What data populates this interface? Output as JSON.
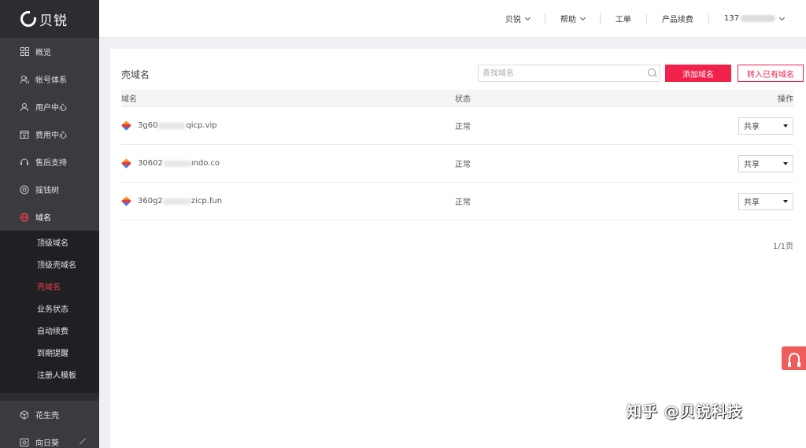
{
  "brand": {
    "name": "贝锐"
  },
  "sidebar": {
    "items": [
      {
        "label": "概览",
        "icon": "dashboard-icon"
      },
      {
        "label": "帐号体系",
        "icon": "users-icon"
      },
      {
        "label": "用户中心",
        "icon": "user-icon"
      },
      {
        "label": "费用中心",
        "icon": "billing-icon"
      },
      {
        "label": "售后支持",
        "icon": "support-icon"
      },
      {
        "label": "摇钱树",
        "icon": "target-icon"
      },
      {
        "label": "域名",
        "icon": "globe-icon"
      }
    ],
    "domain_sub": [
      {
        "label": "顶级域名"
      },
      {
        "label": "顶级壳域名"
      },
      {
        "label": "壳域名"
      },
      {
        "label": "业务状态"
      },
      {
        "label": "自动续费"
      },
      {
        "label": "到期提醒"
      },
      {
        "label": "注册人模板"
      }
    ],
    "bottom_items": [
      {
        "label": "花生壳",
        "icon": "cube-icon"
      },
      {
        "label": "向日葵",
        "icon": "sunflower-icon"
      }
    ]
  },
  "topbar": {
    "brand_menu": "贝锐",
    "help": "帮助",
    "ticket": "工单",
    "renew": "产品续费",
    "account_prefix": "137"
  },
  "panel": {
    "title": "壳域名",
    "search_placeholder": "查找域名",
    "add_button": "添加域名",
    "import_button": "转入已有域名",
    "columns": {
      "domain": "域名",
      "status": "状态",
      "action": "操作"
    },
    "rows": [
      {
        "prefix": "3g60",
        "suffix": "qicp.vip",
        "status": "正常",
        "share": "共享"
      },
      {
        "prefix": "30602",
        "suffix": "ındo.co",
        "status": "正常",
        "share": "共享"
      },
      {
        "prefix": "360g2",
        "suffix": "zicp.fun",
        "status": "正常",
        "share": "共享"
      }
    ],
    "pager": "1/1页"
  },
  "watermark": "知乎 @贝锐科技",
  "colors": {
    "accent": "#f0224b",
    "sidebar_bg": "#2b2d30",
    "support": "#f05c5c"
  }
}
